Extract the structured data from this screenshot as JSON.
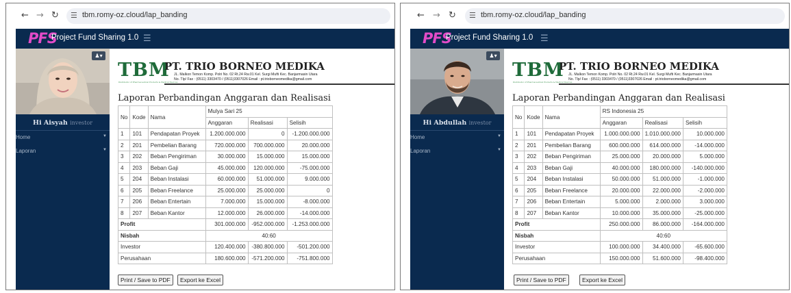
{
  "browser": {
    "url": "tbm.romy-oz.cloud/lap_banding"
  },
  "app": {
    "logo": "PFS",
    "title": "Project Fund Sharing 1.0"
  },
  "menu": {
    "home": "Home",
    "laporan": "Laporan"
  },
  "letterhead": {
    "logo_text": "TBM",
    "logo_sub": "Distributor of Pharmaceutical Products & Medical Devices",
    "company": "PT. TRIO BORNEO MEDIKA",
    "address_line1": "JL. Malkon Temon Komp. Polri No. 02 Rt.24 Rw.01 Kel. Surgi Mufti Kec. Banjarmasin Utara",
    "address_line2": "No. Tlp/ Fax : (0511) 3303470 / (0511)3307026  Email : pt.trioborneomedika@gmail.com"
  },
  "report_title": "Laporan Perbandingan Anggaran dan Realisasi",
  "table_headers": {
    "no": "No",
    "kode": "Kode",
    "nama": "Nama",
    "anggaran": "Anggaran",
    "realisasi": "Realisasi",
    "selisih": "Selisih"
  },
  "labels": {
    "profit": "Profit",
    "nisbah": "Nisbah",
    "investor": "Investor",
    "perusahaan": "Perusahaan"
  },
  "buttons": {
    "print": "Print / Save to PDF",
    "export": "Export ke Excel"
  },
  "panels": [
    {
      "user_greeting": "Hi Aisyah",
      "user_role": "investor",
      "project": "Mulya Sari 25",
      "rows": [
        {
          "no": "1",
          "kode": "101",
          "nama": "Pendapatan Proyek",
          "anggaran": "1.200.000.000",
          "realisasi": "0",
          "selisih": "-1.200.000.000"
        },
        {
          "no": "2",
          "kode": "201",
          "nama": "Pembelian Barang",
          "anggaran": "720.000.000",
          "realisasi": "700.000.000",
          "selisih": "20.000.000"
        },
        {
          "no": "3",
          "kode": "202",
          "nama": "Beban Pengiriman",
          "anggaran": "30.000.000",
          "realisasi": "15.000.000",
          "selisih": "15.000.000"
        },
        {
          "no": "4",
          "kode": "203",
          "nama": "Beban Gaji",
          "anggaran": "45.000.000",
          "realisasi": "120.000.000",
          "selisih": "-75.000.000"
        },
        {
          "no": "5",
          "kode": "204",
          "nama": "Beban Instalasi",
          "anggaran": "60.000.000",
          "realisasi": "51.000.000",
          "selisih": "9.000.000"
        },
        {
          "no": "6",
          "kode": "205",
          "nama": "Beban Freelance",
          "anggaran": "25.000.000",
          "realisasi": "25.000.000",
          "selisih": "0"
        },
        {
          "no": "7",
          "kode": "206",
          "nama": "Beban Entertain",
          "anggaran": "7.000.000",
          "realisasi": "15.000.000",
          "selisih": "-8.000.000"
        },
        {
          "no": "8",
          "kode": "207",
          "nama": "Beban Kantor",
          "anggaran": "12.000.000",
          "realisasi": "26.000.000",
          "selisih": "-14.000.000"
        }
      ],
      "profit": {
        "anggaran": "301.000.000",
        "realisasi": "-952.000.000",
        "selisih": "-1.253.000.000"
      },
      "nisbah": "40:60",
      "investor": {
        "anggaran": "120.400.000",
        "realisasi": "-380.800.000",
        "selisih": "-501.200.000"
      },
      "perusahaan": {
        "anggaran": "180.600.000",
        "realisasi": "-571.200.000",
        "selisih": "-751.800.000"
      }
    },
    {
      "user_greeting": "Hi Abdullah",
      "user_role": "investor",
      "project": "RS Indonesia 25",
      "rows": [
        {
          "no": "1",
          "kode": "101",
          "nama": "Pendapatan Proyek",
          "anggaran": "1.000.000.000",
          "realisasi": "1.010.000.000",
          "selisih": "10.000.000"
        },
        {
          "no": "2",
          "kode": "201",
          "nama": "Pembelian Barang",
          "anggaran": "600.000.000",
          "realisasi": "614.000.000",
          "selisih": "-14.000.000"
        },
        {
          "no": "3",
          "kode": "202",
          "nama": "Beban Pengiriman",
          "anggaran": "25.000.000",
          "realisasi": "20.000.000",
          "selisih": "5.000.000"
        },
        {
          "no": "4",
          "kode": "203",
          "nama": "Beban Gaji",
          "anggaran": "40.000.000",
          "realisasi": "180.000.000",
          "selisih": "-140.000.000"
        },
        {
          "no": "5",
          "kode": "204",
          "nama": "Beban Instalasi",
          "anggaran": "50.000.000",
          "realisasi": "51.000.000",
          "selisih": "-1.000.000"
        },
        {
          "no": "6",
          "kode": "205",
          "nama": "Beban Freelance",
          "anggaran": "20.000.000",
          "realisasi": "22.000.000",
          "selisih": "-2.000.000"
        },
        {
          "no": "7",
          "kode": "206",
          "nama": "Beban Entertain",
          "anggaran": "5.000.000",
          "realisasi": "2.000.000",
          "selisih": "3.000.000"
        },
        {
          "no": "8",
          "kode": "207",
          "nama": "Beban Kantor",
          "anggaran": "10.000.000",
          "realisasi": "35.000.000",
          "selisih": "-25.000.000"
        }
      ],
      "profit": {
        "anggaran": "250.000.000",
        "realisasi": "86.000.000",
        "selisih": "-164.000.000"
      },
      "nisbah": "40:60",
      "investor": {
        "anggaran": "100.000.000",
        "realisasi": "34.400.000",
        "selisih": "-65.600.000"
      },
      "perusahaan": {
        "anggaran": "150.000.000",
        "realisasi": "51.600.000",
        "selisih": "-98.400.000"
      }
    }
  ],
  "icons": {
    "back": "back-arrow-icon",
    "forward": "forward-arrow-icon",
    "reload": "reload-icon",
    "site_settings": "site-settings-icon",
    "menu": "hamburger-menu-icon",
    "user": "user-icon"
  },
  "colors": {
    "navy": "#0a2a4f",
    "logo_pink": "#e24bc7",
    "tbm_green": "#1f6b3a"
  }
}
